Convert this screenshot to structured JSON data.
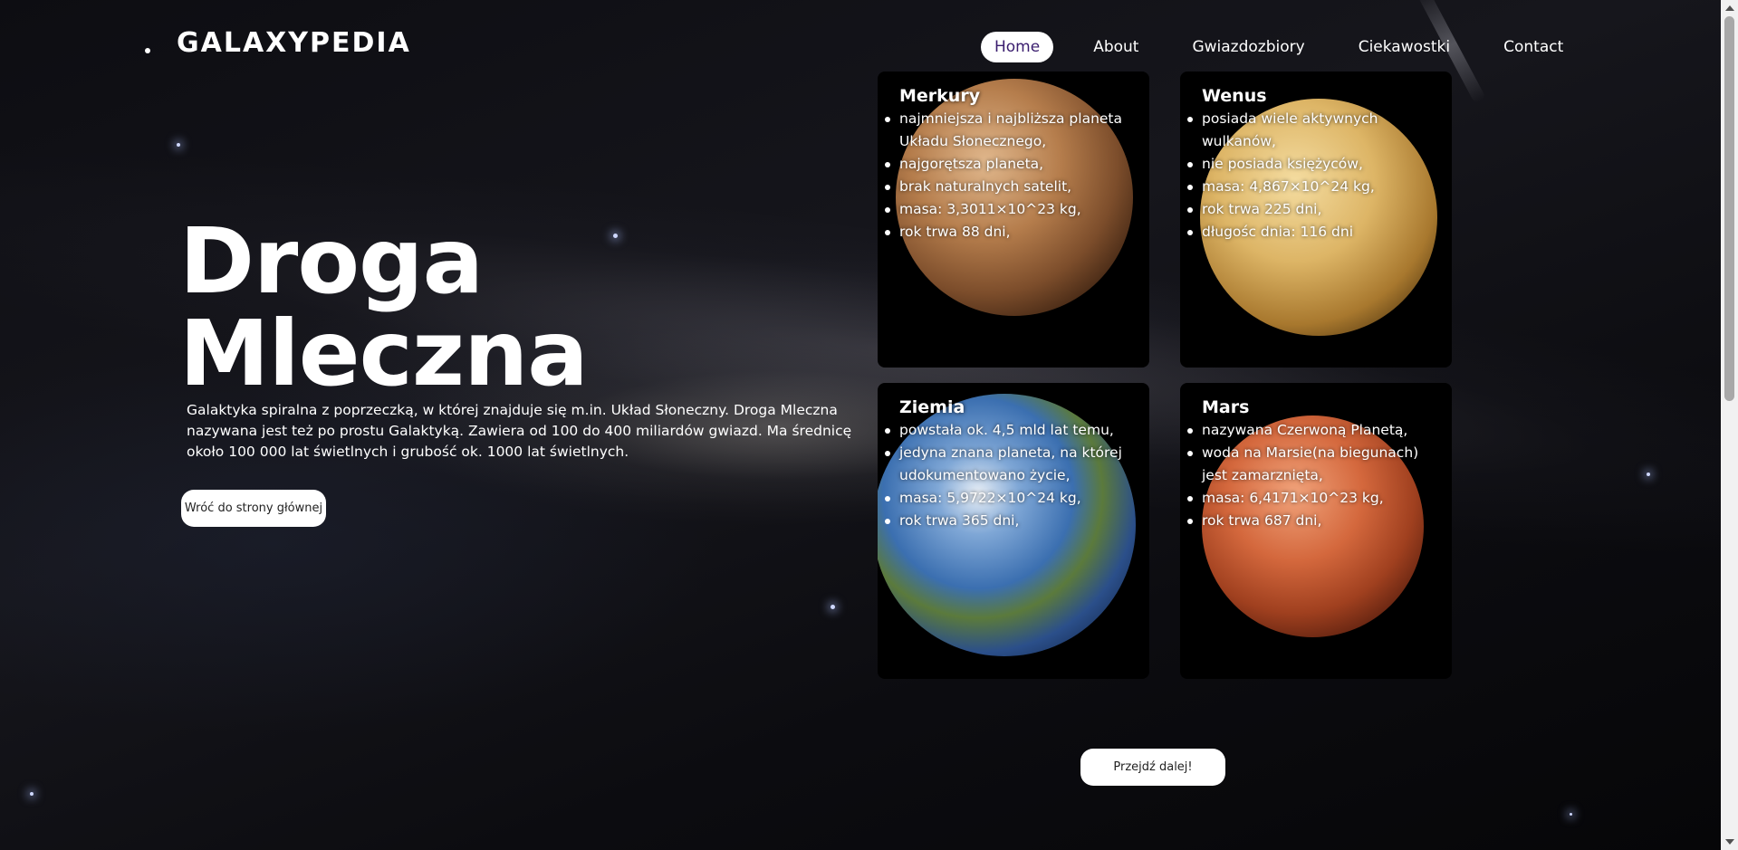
{
  "brand": {
    "logo": "GALAXYPEDIA"
  },
  "nav": {
    "items": [
      {
        "label": "Home",
        "active": true
      },
      {
        "label": "About",
        "active": false
      },
      {
        "label": "Gwiazdozbiory",
        "active": false
      },
      {
        "label": "Ciekawostki",
        "active": false
      },
      {
        "label": "Contact",
        "active": false
      }
    ]
  },
  "hero": {
    "title_line1": "Droga",
    "title_line2": "Mleczna",
    "description": "Galaktyka spiralna z poprzeczką, w której znajduje się m.in. Układ Słoneczny. Droga Mleczna nazywana jest też po prostu Galaktyką. Zawiera od 100 do 400 miliardów gwiazd. Ma średnicę około 100 000 lat świetlnych i grubość ok. 1000 lat świetlnych.",
    "back_button": "Wróć do strony głównej"
  },
  "planets": [
    {
      "name": "Merkury",
      "facts": [
        "najmniejsza i najbliższa planeta Układu Słonecznego,",
        "najgorętsza planeta,",
        "brak naturalnych satelit,",
        "masa: 3,3011×10^23 kg,",
        "rok trwa 88 dni,"
      ],
      "icon": "mercury-planet-icon",
      "color": "#b0703f"
    },
    {
      "name": "Wenus",
      "facts": [
        "posiada wiele aktywnych wulkanów,",
        "nie posiada księżyców,",
        "masa: 4,867×10^24 kg,",
        "rok trwa 225 dni,",
        "długośc dnia: 116 dni"
      ],
      "icon": "venus-planet-icon",
      "color": "#d7a955"
    },
    {
      "name": "Ziemia",
      "facts": [
        "powstała ok. 4,5 mld lat temu,",
        "jedyna znana planeta, na której udokumentowano życie,",
        "masa: 5,9722×10^24 kg,",
        "rok trwa 365 dni,"
      ],
      "icon": "earth-planet-icon",
      "color": "#3b6fb0"
    },
    {
      "name": "Mars",
      "facts": [
        "nazywana Czerwoną Planetą,",
        "woda na Marsie(na biegunach) jest zamarznięta,",
        "masa: 6,4171×10^23 kg,",
        "rok trwa 687 dni,"
      ],
      "icon": "mars-planet-icon",
      "color": "#c2502f"
    }
  ],
  "footer": {
    "next_button": "Przejdź dalej!"
  },
  "theme": {
    "nav_active_text": "#3a1d6e",
    "background": "#08080b"
  }
}
